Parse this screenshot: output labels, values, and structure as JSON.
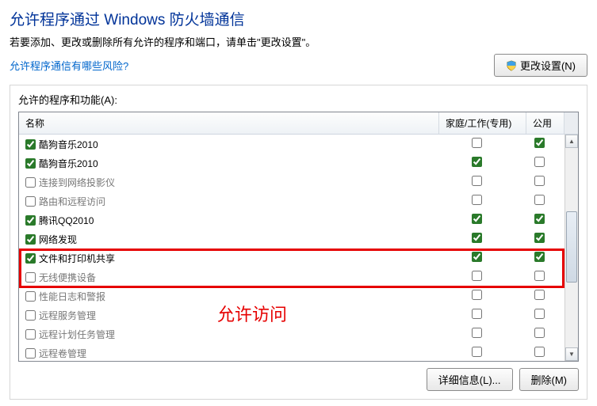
{
  "title": "允许程序通过 Windows 防火墙通信",
  "subtitle": "若要添加、更改或删除所有允许的程序和端口，请单击\"更改设置\"。",
  "risk_link": "允许程序通信有哪些风险?",
  "change_settings_btn": "更改设置(N)",
  "frame_label": "允许的程序和功能(A):",
  "columns": {
    "name": "名称",
    "home": "家庭/工作(专用)",
    "public": "公用"
  },
  "rows": [
    {
      "name": "酷狗音乐2010",
      "enabled": true,
      "home": false,
      "public": true
    },
    {
      "name": "酷狗音乐2010",
      "enabled": true,
      "home": true,
      "public": false
    },
    {
      "name": "连接到网络投影仪",
      "enabled": false,
      "home": false,
      "public": false
    },
    {
      "name": "路由和远程访问",
      "enabled": false,
      "home": false,
      "public": false
    },
    {
      "name": "腾讯QQ2010",
      "enabled": true,
      "home": true,
      "public": true
    },
    {
      "name": "网络发现",
      "enabled": true,
      "home": true,
      "public": true
    },
    {
      "name": "文件和打印机共享",
      "enabled": true,
      "home": true,
      "public": true
    },
    {
      "name": "无线便携设备",
      "enabled": false,
      "home": false,
      "public": false
    },
    {
      "name": "性能日志和警报",
      "enabled": false,
      "home": false,
      "public": false
    },
    {
      "name": "远程服务管理",
      "enabled": false,
      "home": false,
      "public": false
    },
    {
      "name": "远程计划任务管理",
      "enabled": false,
      "home": false,
      "public": false
    },
    {
      "name": "远程卷管理",
      "enabled": false,
      "home": false,
      "public": false
    }
  ],
  "annotation_text": "允许访问",
  "details_btn": "详细信息(L)...",
  "delete_btn": "删除(M)"
}
